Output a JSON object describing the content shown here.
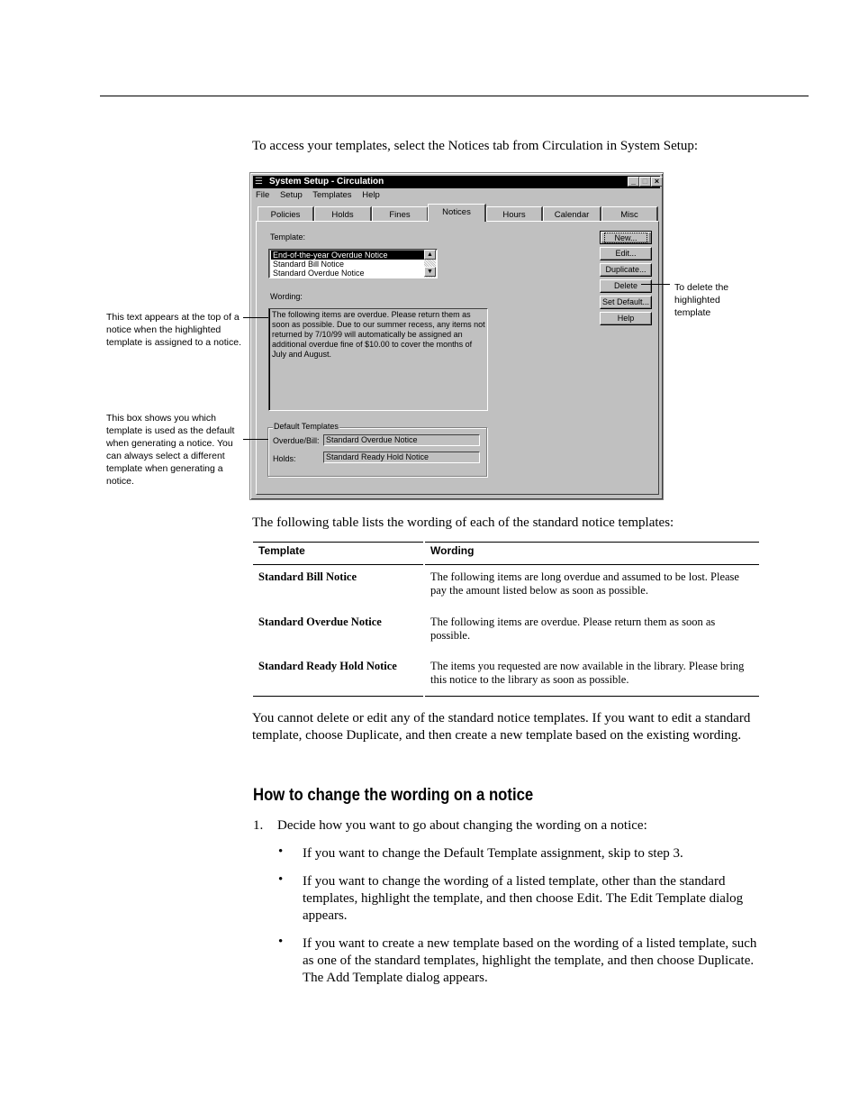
{
  "intro": "To access your templates, select the Notices tab from Circulation in System Setup:",
  "dialog": {
    "title": "System Setup - Circulation",
    "title_icon": "app-icon",
    "title_buttons": [
      "minimize",
      "maximize",
      "close"
    ],
    "menu": [
      "File",
      "Setup",
      "Templates",
      "Help"
    ],
    "tabs": [
      {
        "label": "Policies",
        "active": false
      },
      {
        "label": "Holds",
        "active": false
      },
      {
        "label": "Fines",
        "active": false
      },
      {
        "label": "Notices",
        "active": true
      },
      {
        "label": "Hours",
        "active": false
      },
      {
        "label": "Calendar",
        "active": false
      },
      {
        "label": "Misc",
        "active": false
      }
    ],
    "template_label": "Template:",
    "templates": [
      {
        "label": "End-of-the-year Overdue Notice",
        "selected": true
      },
      {
        "label": "Standard Bill Notice",
        "selected": false
      },
      {
        "label": "Standard Overdue Notice",
        "selected": false
      }
    ],
    "wording_label": "Wording:",
    "wording_text": "The following items are overdue. Please return them as soon as possible. Due to our summer recess, any items not returned by 7/10/99 will automatically be assigned an additional overdue fine of $10.00 to cover the months of July and August.",
    "default_templates": {
      "legend": "Default Templates",
      "overdue_bill_label": "Overdue/Bill:",
      "overdue_bill_value": "Standard Overdue Notice",
      "holds_label": "Holds:",
      "holds_value": "Standard Ready Hold Notice"
    },
    "buttons": [
      "New...",
      "Edit...",
      "Duplicate...",
      "Delete",
      "Set Default...",
      "Help"
    ]
  },
  "callouts": {
    "delete": "To delete the highlighted template",
    "wording": "This text appears at the top of a notice when the highlighted template is assigned to a notice.",
    "defaults": "This box shows you which template is used as the default when generating a notice. You can always select a different template when generating a notice."
  },
  "table_intro": "The following table lists the wording of each of the standard notice templates:",
  "table": {
    "headers": [
      "Template",
      "Wording"
    ],
    "rows": [
      {
        "template": "Standard Bill Notice",
        "wording": "The following items are long overdue and assumed to be lost. Please pay the amount listed below as soon as possible."
      },
      {
        "template": "Standard Overdue Notice",
        "wording": "The following items are overdue. Please return them as soon as possible."
      },
      {
        "template": "Standard Ready Hold Notice",
        "wording": "The items you requested are now available in the library. Please bring this notice to the library as soon as possible."
      }
    ]
  },
  "after_table": "You cannot delete or edit any of the standard notice templates. If you want to edit a standard template, choose Duplicate, and then create a new template based on the existing wording.",
  "heading": "How to change the wording on a notice",
  "step1": {
    "number": "1.",
    "text": "Decide how you want to go about changing the wording on a notice:",
    "bullets": [
      "If you want to change the Default Template assignment, skip to step 3.",
      "If you want to change the wording of a listed template, other than the standard templates, highlight the template, and then choose Edit. The Edit Template dialog appears.",
      "If you want to create a new template based on the wording of a listed template, such as one of the standard templates, highlight the template, and then choose Duplicate. The Add Template dialog appears."
    ]
  }
}
